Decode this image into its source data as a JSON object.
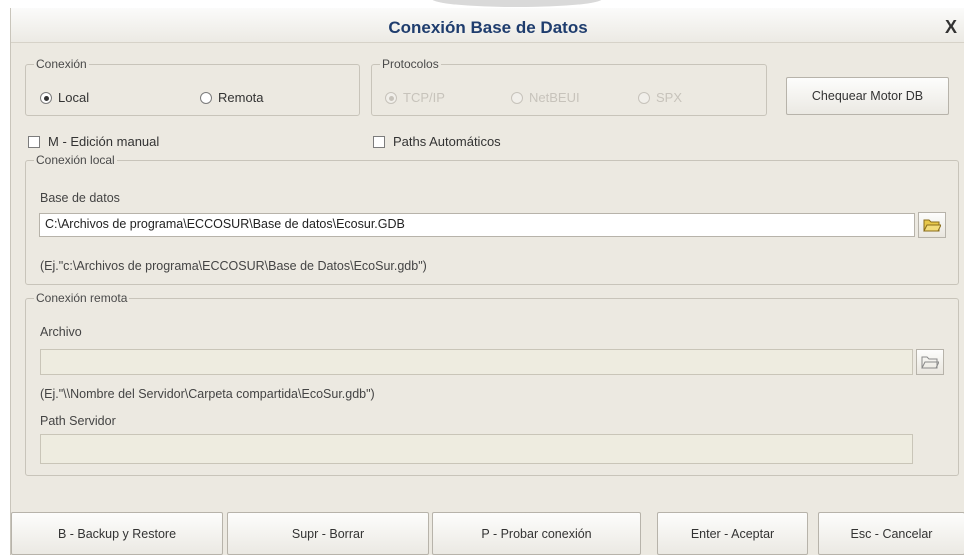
{
  "window": {
    "title": "Conexión Base de Datos",
    "close": "X"
  },
  "conexion": {
    "legend": "Conexión",
    "options": [
      {
        "label": "Local",
        "selected": true
      },
      {
        "label": "Remota",
        "selected": false
      }
    ]
  },
  "protocolos": {
    "legend": "Protocolos",
    "options": [
      {
        "label": "TCP/IP",
        "selected": true
      },
      {
        "label": "NetBEUI",
        "selected": false
      },
      {
        "label": "SPX",
        "selected": false
      }
    ]
  },
  "chequear_button": "Chequear Motor DB",
  "checkboxes": {
    "manual": "M - Edición manual",
    "paths": "Paths Automáticos"
  },
  "local": {
    "legend": "Conexión local",
    "db_label": "Base de datos",
    "db_value": "C:\\Archivos de programa\\ECCOSUR\\Base de datos\\Ecosur.GDB",
    "example": "(Ej.\"c:\\Archivos de programa\\ECCOSUR\\Base de Datos\\EcoSur.gdb\")"
  },
  "remota": {
    "legend": "Conexión remota",
    "archivo_label": "Archivo",
    "archivo_value": "",
    "example": "(Ej.\"\\\\Nombre del Servidor\\Carpeta compartida\\EcoSur.gdb\")",
    "path_label": "Path Servidor",
    "path_value": ""
  },
  "buttons": {
    "backup": "B - Backup y Restore",
    "borrar": "Supr - Borrar",
    "probar": "P - Probar conexión",
    "aceptar": "Enter - Aceptar",
    "cancelar": "Esc - Cancelar"
  },
  "colors": {
    "title": "#1f3d6e",
    "window_bg": "#ece9e1",
    "disabled_field": "#eeece0",
    "folder_icon": "#e8c84a"
  }
}
